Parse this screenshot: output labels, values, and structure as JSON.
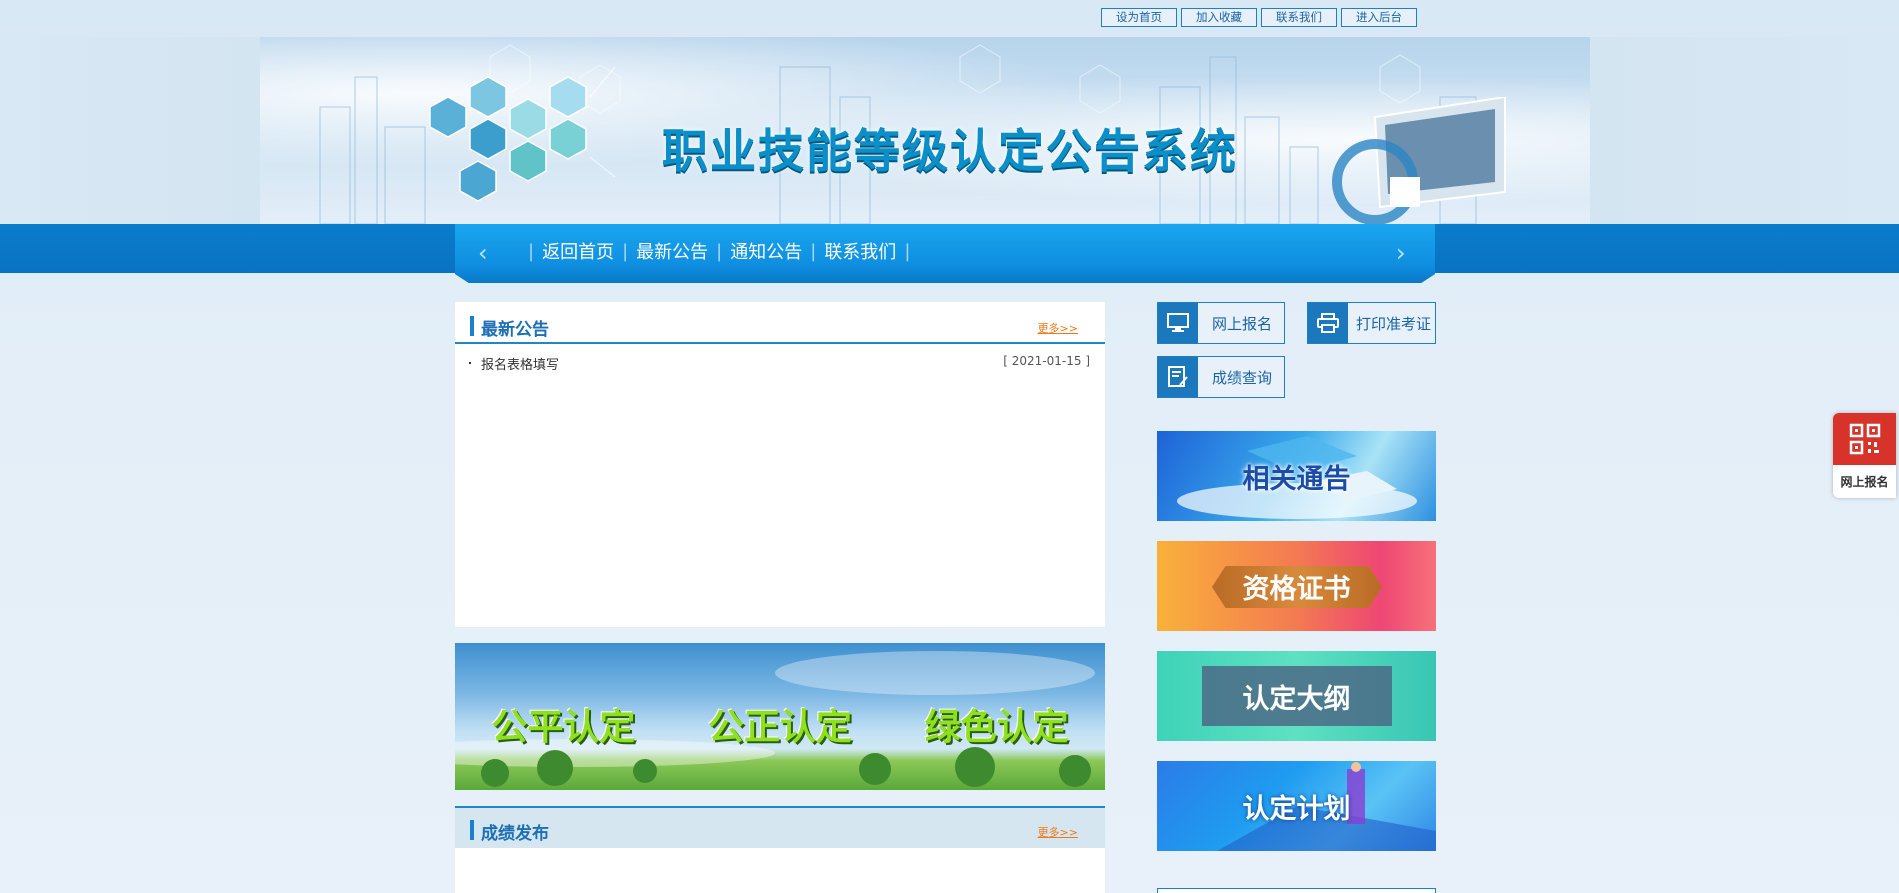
{
  "top_links": [
    "设为首页",
    "加入收藏",
    "联系我们",
    "进入后台"
  ],
  "banner": {
    "title": "职业技能等级认定公告系统"
  },
  "nav": {
    "prev_icon": "chevron-left-icon",
    "next_icon": "chevron-right-icon",
    "items": [
      "返回首页",
      "最新公告",
      "通知公告",
      "联系我们"
    ]
  },
  "latest": {
    "title": "最新公告",
    "more": "更多>>",
    "items": [
      {
        "title": "报名表格填写",
        "date": "[ 2021-01-15 ]"
      }
    ]
  },
  "slogan": {
    "words": [
      "公平认定",
      "公正认定",
      "绿色认定"
    ]
  },
  "results": {
    "title": "成绩发布",
    "more": "更多>>"
  },
  "quick_buttons": [
    {
      "label": "网上报名",
      "icon": "monitor-icon"
    },
    {
      "label": "打印准考证",
      "icon": "printer-icon"
    },
    {
      "label": "成绩查询",
      "icon": "document-edit-icon"
    }
  ],
  "promos": [
    "相关通告",
    "资格证书",
    "认定大纲",
    "认定计划"
  ],
  "float_widget": {
    "label": "网上报名",
    "icon": "qr-code-icon",
    "color": "#d8332b"
  },
  "colors": {
    "accent": "#1a7fd1",
    "nav": "#0a7ccc",
    "more": "#f07818"
  }
}
